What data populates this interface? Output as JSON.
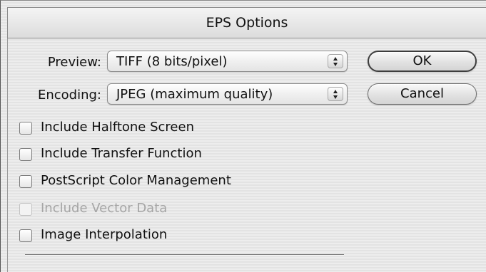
{
  "dialog": {
    "title": "EPS Options",
    "preview_label": "Preview:",
    "preview_value": "TIFF  (8 bits/pixel)",
    "encoding_label": "Encoding:",
    "encoding_value": "JPEG  (maximum quality)",
    "ok_label": "OK",
    "cancel_label": "Cancel",
    "checkboxes": [
      {
        "label": "Include Halftone Screen",
        "checked": false,
        "enabled": true
      },
      {
        "label": "Include Transfer Function",
        "checked": false,
        "enabled": true
      },
      {
        "label": "PostScript Color Management",
        "checked": false,
        "enabled": true
      },
      {
        "label": "Include Vector Data",
        "checked": false,
        "enabled": false
      },
      {
        "label": "Image Interpolation",
        "checked": false,
        "enabled": true
      }
    ]
  },
  "icons": {
    "popup_arrows": "updown-chevron-icon"
  },
  "colors": {
    "background": "#ececec",
    "disabled_text": "#a5a5a5"
  }
}
